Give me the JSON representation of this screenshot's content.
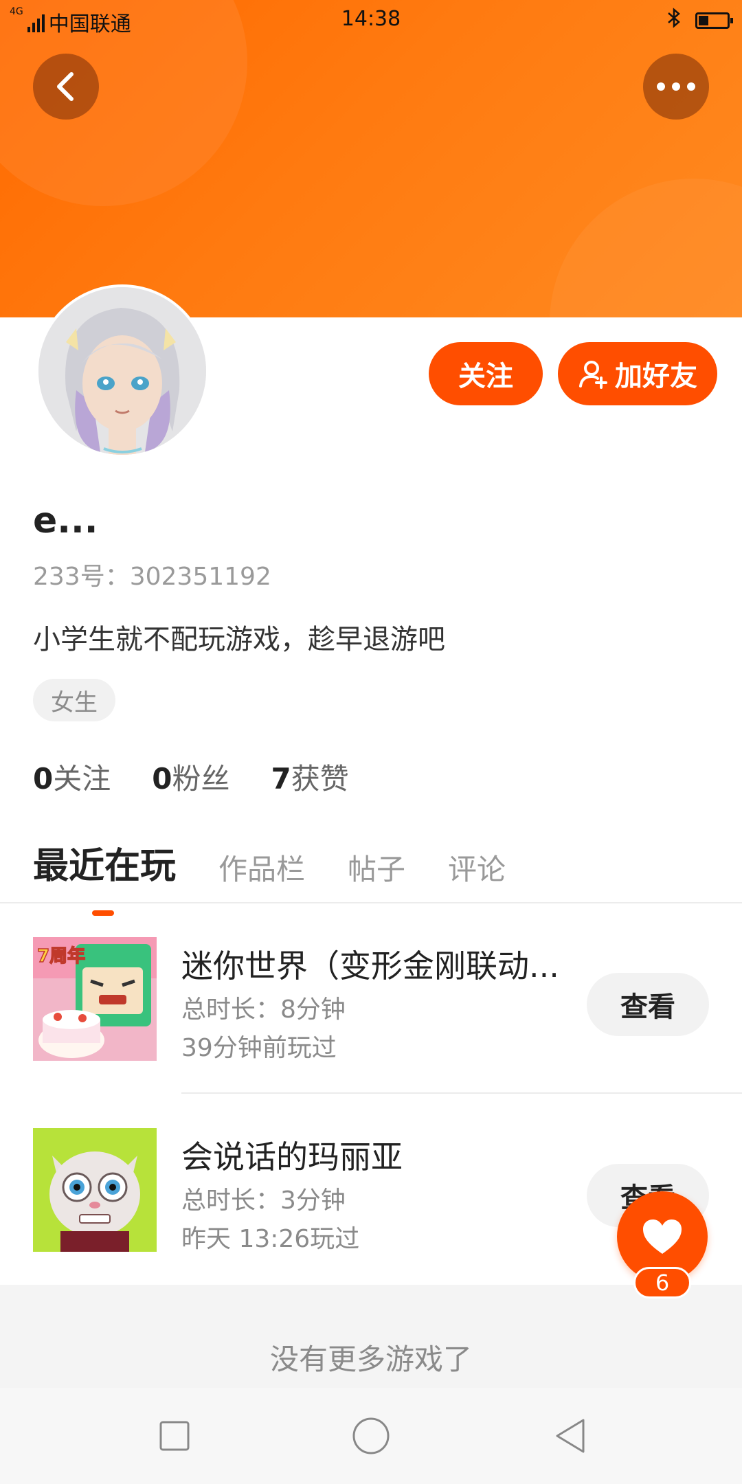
{
  "status_bar": {
    "network": "4G",
    "carrier": "中国联通",
    "time": "14:38",
    "bluetooth_icon": "bluetooth-icon",
    "battery_icon": "battery-icon"
  },
  "header": {
    "back_icon": "chevron-left-icon",
    "more_icon": "more-dots-icon",
    "accent_color": "#ff4e00"
  },
  "profile": {
    "username": "e...",
    "id_text": "233号：302351192",
    "bio": "小学生就不配玩游戏，趁早退游吧",
    "gender_tag": "女生",
    "follow_button": "关注",
    "add_friend_button": "加好友",
    "stats": {
      "following_count": "0",
      "following_label": "关注",
      "fans_count": "0",
      "fans_label": "粉丝",
      "likes_count": "7",
      "likes_label": "获赞"
    }
  },
  "tabs": [
    {
      "label": "最近在玩",
      "active": true
    },
    {
      "label": "作品栏",
      "active": false
    },
    {
      "label": "帖子",
      "active": false
    },
    {
      "label": "评论",
      "active": false
    }
  ],
  "games": [
    {
      "title": "迷你世界（变形金刚联动...",
      "duration": "总时长：8分钟",
      "last_played": "39分钟前玩过",
      "thumb_badge": "7周年",
      "view_button": "查看"
    },
    {
      "title": "会说话的玛丽亚",
      "duration": "总时长：3分钟",
      "last_played": "昨天 13:26玩过",
      "view_button": "查看"
    }
  ],
  "no_more_text": "没有更多游戏了",
  "like_fab": {
    "icon": "heart-icon",
    "count": "6"
  },
  "nav": {
    "recent_icon": "square-icon",
    "home_icon": "circle-icon",
    "back_icon": "triangle-back-icon"
  }
}
